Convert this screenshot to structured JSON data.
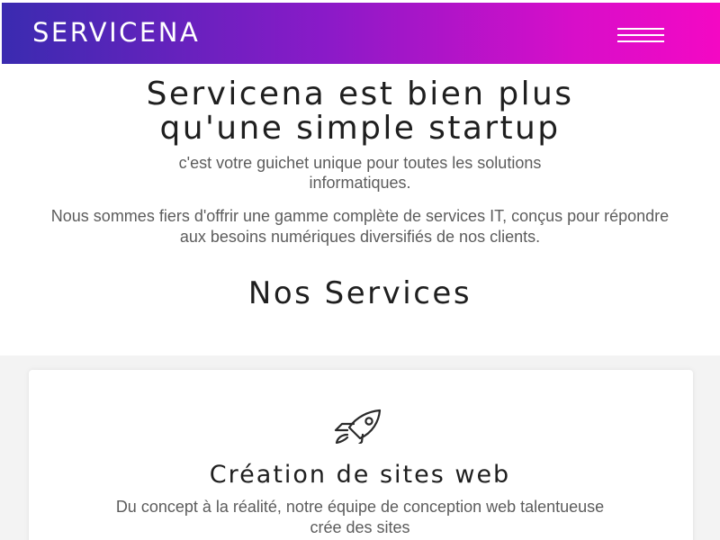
{
  "navbar": {
    "brand": "SERVICENA",
    "menu_icon": "hamburger-menu-icon",
    "gradient_colors": [
      "#3a2bb0",
      "#8a1ac8",
      "#d80ec9",
      "#f408c4"
    ]
  },
  "hero": {
    "title_line1": "Servicena est bien plus",
    "title_line2": "qu'une simple startup",
    "subtitle": "c'est votre guichet unique pour toutes les solutions informatiques.",
    "description": "Nous sommes fiers d'offrir une gamme complète de services IT, conçus pour répondre aux besoins numériques diversifiés de nos clients."
  },
  "services": {
    "title": "Nos Services",
    "cards": [
      {
        "icon": "rocket-icon",
        "title": "Création de sites web",
        "text": "Du concept à la réalité, notre équipe de conception web talentueuse crée des sites"
      }
    ]
  }
}
